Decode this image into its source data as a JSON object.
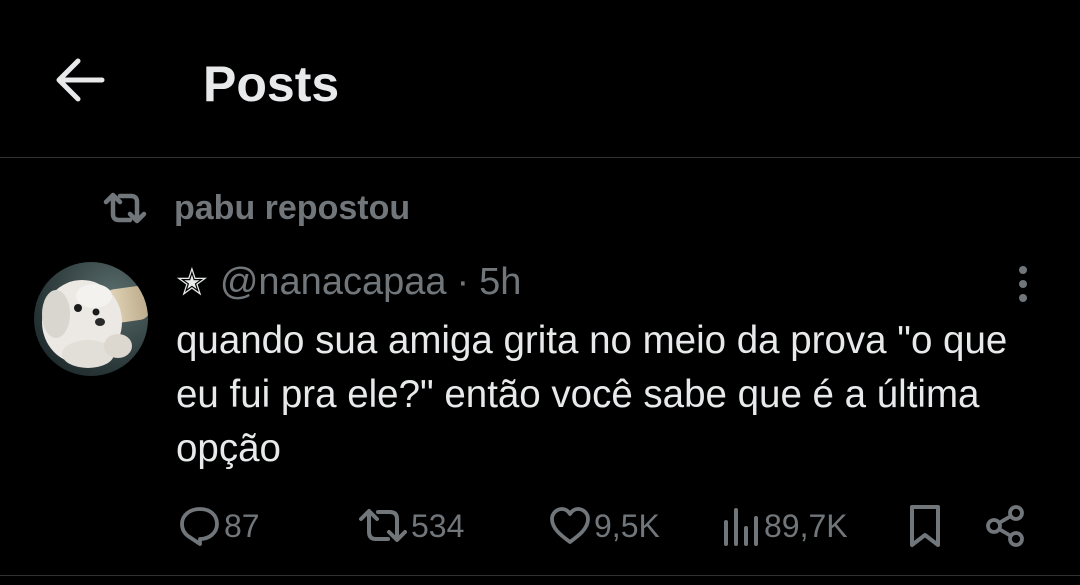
{
  "header": {
    "title": "Posts"
  },
  "repost": {
    "label": "pabu repostou"
  },
  "post": {
    "prefix_symbol": "✭",
    "handle": "@nanacapaa",
    "separator": "·",
    "time": "5h",
    "text": "quando sua amiga grita no meio da prova \"o que eu fui pra ele?\" então você sabe que é a última opção"
  },
  "actions": {
    "replies": "87",
    "reposts": "534",
    "likes": "9,5K",
    "views": "89,7K"
  },
  "icons": {
    "back": "arrow-left-icon",
    "repost": "repost-icon",
    "more": "more-vertical-icon",
    "reply": "reply-icon",
    "like": "heart-icon",
    "views": "analytics-icon",
    "bookmark": "bookmark-icon",
    "share": "share-icon"
  },
  "colors": {
    "background": "#000000",
    "text_primary": "#e7e9ea",
    "text_secondary": "#71767b",
    "divider": "#2f3336"
  }
}
